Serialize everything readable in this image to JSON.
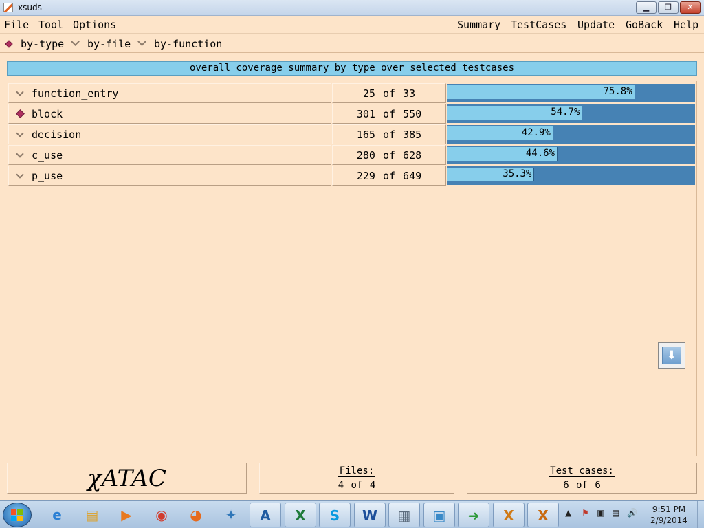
{
  "window": {
    "title": "xsuds",
    "controls": {
      "minimize": "▁",
      "maximize": "❐",
      "close": "✕"
    }
  },
  "menu": {
    "left": [
      "File",
      "Tool",
      "Options"
    ],
    "right": [
      "Summary",
      "TestCases",
      "Update",
      "GoBack",
      "Help"
    ]
  },
  "views": {
    "selected": "by-type",
    "items": [
      "by-type",
      "by-file",
      "by-function"
    ]
  },
  "summary": {
    "header": "overall coverage summary by type over selected testcases",
    "selected_type": "block",
    "rows": [
      {
        "type": "function_entry",
        "count": "25 of 33",
        "percent_label": "75.8%",
        "percent": 75.8
      },
      {
        "type": "block",
        "count": "301 of 550",
        "percent_label": "54.7%",
        "percent": 54.7
      },
      {
        "type": "decision",
        "count": "165 of 385",
        "percent_label": "42.9%",
        "percent": 42.9
      },
      {
        "type": "c_use",
        "count": "280 of 628",
        "percent_label": "44.6%",
        "percent": 44.6
      },
      {
        "type": "p_use",
        "count": "229 of 649",
        "percent_label": "35.3%",
        "percent": 35.3
      }
    ]
  },
  "footer": {
    "logo": "χATAC",
    "files_label": "Files:",
    "files_value": "4 of 4",
    "tests_label": "Test cases:",
    "tests_value": "6 of 6"
  },
  "colors": {
    "background": "#fde4c9",
    "bar_track": "#4682b4",
    "bar_fill": "#87ceeb",
    "selected_indicator": "#b03060"
  },
  "taskbar": {
    "apps": [
      {
        "name": "internet-explorer",
        "glyph": "e",
        "color": "#2a7fd4"
      },
      {
        "name": "file-explorer",
        "glyph": "▤",
        "color": "#d9a53a"
      },
      {
        "name": "media-player",
        "glyph": "▶",
        "color": "#e8791f"
      },
      {
        "name": "chrome",
        "glyph": "◉",
        "color": "#d23c2e"
      },
      {
        "name": "firefox",
        "glyph": "◕",
        "color": "#e66a1d"
      },
      {
        "name": "network-app",
        "glyph": "✦",
        "color": "#2f76b8"
      },
      {
        "name": "publisher",
        "glyph": "A",
        "color": "#1e5aa0"
      },
      {
        "name": "excel",
        "glyph": "X",
        "color": "#1e7a3a"
      },
      {
        "name": "skype",
        "glyph": "S",
        "color": "#0a9be0"
      },
      {
        "name": "word",
        "glyph": "W",
        "color": "#1d4f9a"
      },
      {
        "name": "calculator",
        "glyph": "▦",
        "color": "#5d6d7e"
      },
      {
        "name": "photo-viewer",
        "glyph": "▣",
        "color": "#3a8ac8"
      },
      {
        "name": "xming-launch",
        "glyph": "➜",
        "color": "#2e9a3a"
      },
      {
        "name": "xming",
        "glyph": "X",
        "color": "#d07a16"
      },
      {
        "name": "xming-active",
        "glyph": "X",
        "color": "#c86a10"
      }
    ],
    "tray_icons": [
      "▲",
      "⚑",
      "▣",
      "▤",
      "🔊"
    ],
    "time": "9:51 PM",
    "date": "2/9/2014"
  }
}
